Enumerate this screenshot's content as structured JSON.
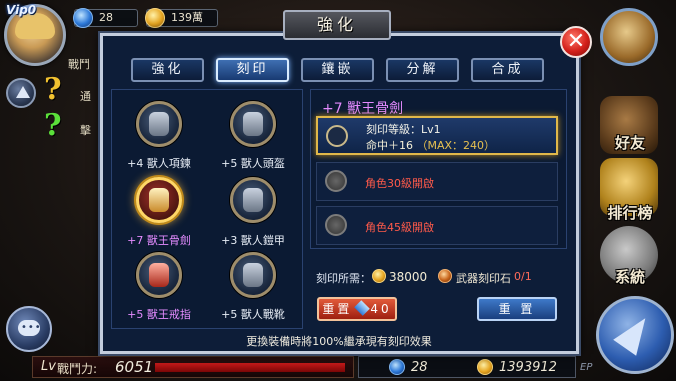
{
  "hud": {
    "vip_label": "Vip0",
    "gems": "28",
    "gold": "139萬",
    "side_text_1": "戰鬥",
    "side_text_2": "通",
    "side_text_3": "擊"
  },
  "right_menu": {
    "friends_label": "好友",
    "ranking_label": "排行榜",
    "system_label": "系統"
  },
  "bottom": {
    "lv_label": "Lv",
    "power_label": "戰鬥力:",
    "power_value": "6051",
    "gems": "28",
    "gold": "1393912",
    "ep_label": "EP"
  },
  "dialog": {
    "title": "強化",
    "close_symbol": "✕",
    "tabs": [
      {
        "label": "強化",
        "active": false
      },
      {
        "label": "刻印",
        "active": true
      },
      {
        "label": "鑲嵌",
        "active": false
      },
      {
        "label": "分解",
        "active": false
      },
      {
        "label": "合成",
        "active": false
      }
    ],
    "items": [
      {
        "name": "+4 獸人項鍊",
        "selected": false,
        "color": "#e6ecf5"
      },
      {
        "name": "+5 獸人頭盔",
        "selected": false,
        "color": "#e6ecf5"
      },
      {
        "name": "+7 獸王骨劍",
        "selected": true,
        "color": "#e58cff"
      },
      {
        "name": "+3 獸人鎧甲",
        "selected": false,
        "color": "#e6ecf5"
      },
      {
        "name": "+5 獸王戒指",
        "selected": false,
        "color": "#e58cff"
      },
      {
        "name": "+5 獸人戰靴",
        "selected": false,
        "color": "#e6ecf5"
      }
    ],
    "selected_item_title": "+7 獸王骨劍",
    "engrave_slots": [
      {
        "line1": "刻印等級：Lv1",
        "line2_prefix": "命中＋16",
        "line2_max": "（MAX：240）",
        "locked": false
      },
      {
        "text": "角色30級開啟",
        "locked": true
      },
      {
        "text": "角色45級開啟",
        "locked": true
      }
    ],
    "cost_label": "刻印所需：",
    "cost_gold": "38000",
    "stone_label": "武器刻印石",
    "stone_count": "0/1",
    "reset_gem_label": "重置",
    "reset_gem_cost": "40",
    "reset_label": "重 置",
    "footer_note": "更換裝備時將100%繼承現有刻印效果"
  }
}
